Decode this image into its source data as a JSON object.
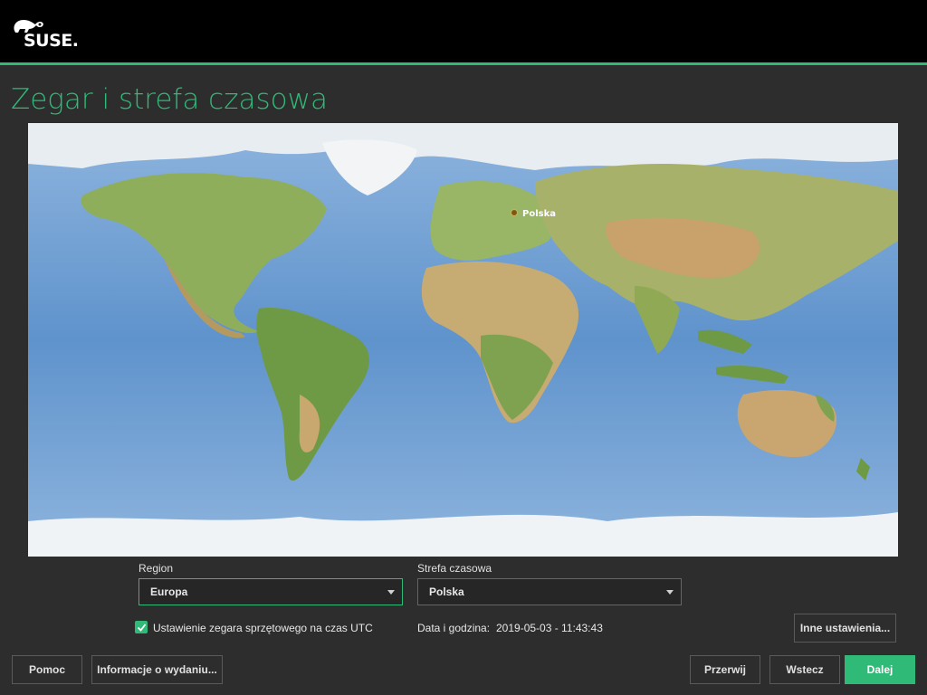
{
  "header": {
    "logo_text": "SUSE.",
    "accent_color": "#30ba78"
  },
  "page": {
    "title": "Zegar i strefa czasowa"
  },
  "map": {
    "selected_marker": "Polska"
  },
  "region": {
    "label": "Region",
    "value": "Europa"
  },
  "timezone": {
    "label": "Strefa czasowa",
    "value": "Polska"
  },
  "hw_clock": {
    "checked": true,
    "label": "Ustawienie zegara sprzętowego na czas UTC"
  },
  "datetime": {
    "label": "Data i godzina:",
    "value": "2019-05-03 - 11:43:43"
  },
  "buttons": {
    "other_settings": "Inne ustawienia...",
    "help": "Pomoc",
    "release_notes": "Informacje o wydaniu...",
    "abort": "Przerwij",
    "back": "Wstecz",
    "next": "Dalej"
  }
}
